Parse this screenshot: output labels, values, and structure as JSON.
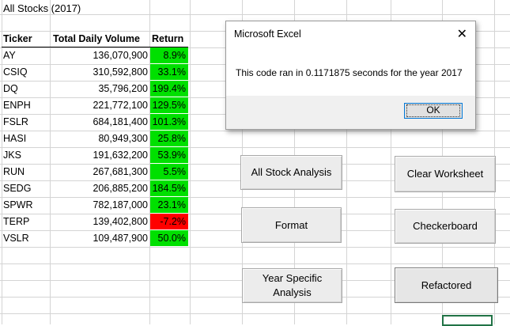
{
  "sheet": {
    "title": "All Stocks (2017)",
    "headers": {
      "ticker": "Ticker",
      "volume": "Total Daily Volume",
      "return": "Return"
    },
    "rows": [
      {
        "ticker": "AY",
        "volume": "136,070,900",
        "return": "8.9%",
        "status": "positive"
      },
      {
        "ticker": "CSIQ",
        "volume": "310,592,800",
        "return": "33.1%",
        "status": "positive"
      },
      {
        "ticker": "DQ",
        "volume": "35,796,200",
        "return": "199.4%",
        "status": "positive"
      },
      {
        "ticker": "ENPH",
        "volume": "221,772,100",
        "return": "129.5%",
        "status": "positive"
      },
      {
        "ticker": "FSLR",
        "volume": "684,181,400",
        "return": "101.3%",
        "status": "positive"
      },
      {
        "ticker": "HASI",
        "volume": "80,949,300",
        "return": "25.8%",
        "status": "positive"
      },
      {
        "ticker": "JKS",
        "volume": "191,632,200",
        "return": "53.9%",
        "status": "positive"
      },
      {
        "ticker": "RUN",
        "volume": "267,681,300",
        "return": "5.5%",
        "status": "positive"
      },
      {
        "ticker": "SEDG",
        "volume": "206,885,200",
        "return": "184.5%",
        "status": "positive"
      },
      {
        "ticker": "SPWR",
        "volume": "782,187,000",
        "return": "23.1%",
        "status": "positive"
      },
      {
        "ticker": "TERP",
        "volume": "139,402,800",
        "return": "-7.2%",
        "status": "negative"
      },
      {
        "ticker": "VSLR",
        "volume": "109,487,900",
        "return": "50.0%",
        "status": "positive"
      }
    ]
  },
  "buttons": {
    "all_stock_analysis": "All Stock Analysis",
    "clear_worksheet": "Clear Worksheet",
    "format": "Format",
    "checkerboard": "Checkerboard",
    "year_specific_line1": "Year Specific",
    "year_specific_line2": "Analysis",
    "refactored": "Refactored"
  },
  "dialog": {
    "title": "Microsoft Excel",
    "message": "This code ran in 0.1171875 seconds for the year 2017",
    "ok_label": "OK",
    "close_icon": "close-icon"
  },
  "colors": {
    "positive": "#00e000",
    "negative": "#ff0000",
    "gridline": "#d4d4d4",
    "selection": "#217346"
  }
}
